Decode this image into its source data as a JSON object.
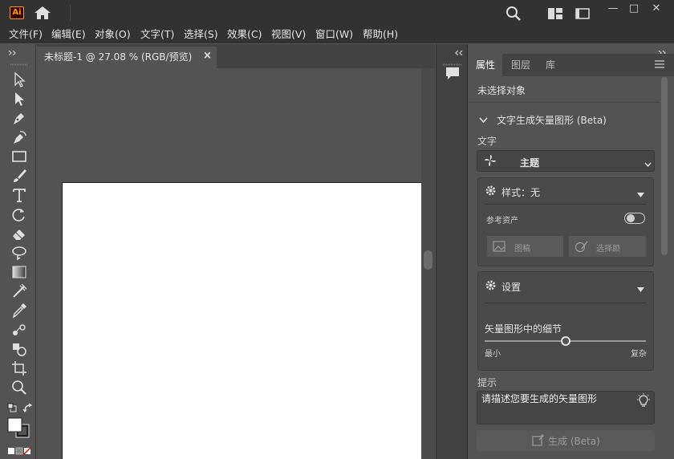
{
  "app": {
    "logo_text": "Ai",
    "accent_color": "#ff9a00"
  },
  "window_controls": {
    "minimize": "—",
    "maximize": "□",
    "close": "✕"
  },
  "menu": [
    "文件(F)",
    "编辑(E)",
    "对象(O)",
    "文字(T)",
    "选择(S)",
    "效果(C)",
    "视图(V)",
    "窗口(W)",
    "帮助(H)"
  ],
  "document": {
    "tab_label": "未标题-1 @ 27.08 % (RGB/预览)",
    "close_glyph": "×"
  },
  "panel": {
    "tabs": [
      "属性",
      "图层",
      "库"
    ],
    "no_selection": "未选择对象",
    "section_title": "文字生成矢量图形 (Beta)",
    "text_label": "文字",
    "theme_value": "主题",
    "style_title": "样式：无",
    "reference_assets": "参考资产",
    "pattern_button": "图稿",
    "color_button": "选择颜",
    "settings_title": "设置",
    "detail_label": "矢量图形中的细节",
    "detail_min": "最小",
    "detail_max": "复杂",
    "detail_level_percent": 50,
    "prompt_label": "提示",
    "prompt_value": "请描述您要生成的矢量图形",
    "generate_button": "生成 (Beta)"
  }
}
